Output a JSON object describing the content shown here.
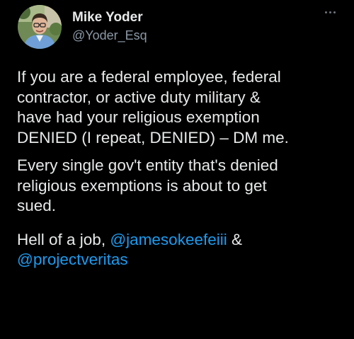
{
  "tweet": {
    "author_name": "Mike Yoder",
    "author_handle": "@Yoder_Esq",
    "more_icon": "more-horizontal-icon",
    "paragraphs": [
      {
        "lines": [
          "If you are a federal employee, federal",
          "contractor, or active duty military &",
          "have had your religious exemption",
          "DENIED (I repeat, DENIED) – DM me."
        ]
      },
      {
        "lines": [
          "Every single gov't entity that's denied",
          "religious exemptions is about to get",
          "sued."
        ]
      }
    ],
    "closing": {
      "prefix": "Hell of a job, ",
      "mention1": "@jamesokeefeiii",
      "joiner": " &",
      "mention2": "@projectveritas"
    }
  },
  "colors": {
    "background": "#000000",
    "text": "#e7e9ea",
    "secondary": "#8b98a5",
    "link": "#1d9bf0"
  }
}
